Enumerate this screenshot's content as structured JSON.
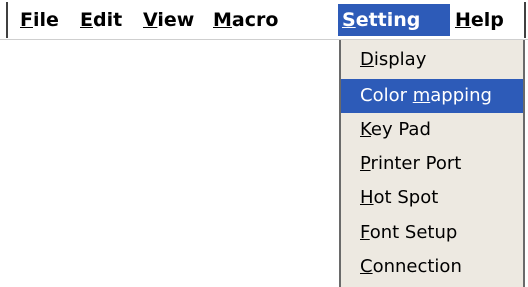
{
  "menubar": {
    "items": [
      {
        "pre": "",
        "key": "F",
        "post": "ile"
      },
      {
        "pre": "",
        "key": "E",
        "post": "dit"
      },
      {
        "pre": "",
        "key": "V",
        "post": "iew"
      },
      {
        "pre": "",
        "key": "M",
        "post": "acro"
      },
      {
        "pre": "",
        "key": "S",
        "post": "etting"
      },
      {
        "pre": "",
        "key": "H",
        "post": "elp"
      }
    ],
    "active_index": 4
  },
  "setting_menu": {
    "items": [
      {
        "pre": "",
        "key": "D",
        "post": "isplay"
      },
      {
        "pre": "Color ",
        "key": "m",
        "post": "apping"
      },
      {
        "pre": "",
        "key": "K",
        "post": "ey Pad"
      },
      {
        "pre": "",
        "key": "P",
        "post": "rinter Port"
      },
      {
        "pre": "",
        "key": "H",
        "post": "ot Spot"
      },
      {
        "pre": "",
        "key": "F",
        "post": "ont Setup"
      },
      {
        "pre": "",
        "key": "C",
        "post": "onnection"
      }
    ],
    "highlighted_index": 1
  },
  "colors": {
    "highlight": "#2d5bb8",
    "menu_background": "#ede9e1"
  }
}
